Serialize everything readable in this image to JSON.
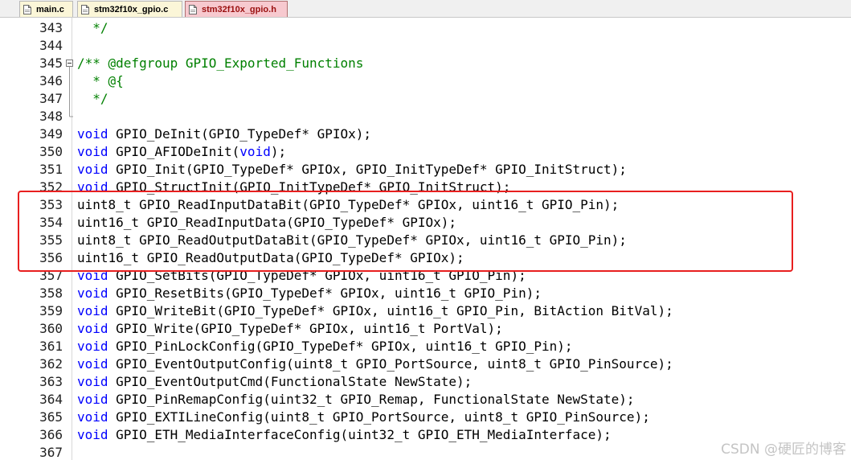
{
  "tabs": [
    {
      "label": "main.c",
      "active": false,
      "icon": "c-file-icon"
    },
    {
      "label": "stm32f10x_gpio.c",
      "active": false,
      "icon": "c-file-icon"
    },
    {
      "label": "stm32f10x_gpio.h",
      "active": true,
      "icon": "h-file-icon"
    }
  ],
  "highlight_color": "#e81f1f",
  "colors": {
    "keyword": "#0000ff",
    "comment": "#008000",
    "tab_active": "#f7c9cf",
    "tab_inactive": "#fbf6d8"
  },
  "watermark": "CSDN @硬匠的博客",
  "lines": [
    {
      "num": "343",
      "fold": "none",
      "parts": [
        {
          "t": "  */",
          "c": "cm"
        }
      ]
    },
    {
      "num": "344",
      "fold": "none",
      "parts": []
    },
    {
      "num": "345",
      "fold": "open",
      "parts": [
        {
          "t": "/** @defgroup GPIO_Exported_Functions",
          "c": "cm"
        }
      ]
    },
    {
      "num": "346",
      "fold": "line",
      "parts": [
        {
          "t": "  * @{",
          "c": "cm"
        }
      ]
    },
    {
      "num": "347",
      "fold": "line",
      "parts": [
        {
          "t": "  */",
          "c": "cm"
        }
      ]
    },
    {
      "num": "348",
      "fold": "end",
      "parts": []
    },
    {
      "num": "349",
      "fold": "none",
      "parts": [
        {
          "t": "void",
          "c": "kw"
        },
        {
          "t": " GPIO_DeInit(GPIO_TypeDef* GPIOx);",
          "c": ""
        }
      ]
    },
    {
      "num": "350",
      "fold": "none",
      "parts": [
        {
          "t": "void",
          "c": "kw"
        },
        {
          "t": " GPIO_AFIODeInit(",
          "c": ""
        },
        {
          "t": "void",
          "c": "kw"
        },
        {
          "t": ");",
          "c": ""
        }
      ]
    },
    {
      "num": "351",
      "fold": "none",
      "parts": [
        {
          "t": "void",
          "c": "kw"
        },
        {
          "t": " GPIO_Init(GPIO_TypeDef* GPIOx, GPIO_InitTypeDef* GPIO_InitStruct);",
          "c": ""
        }
      ]
    },
    {
      "num": "352",
      "fold": "none",
      "parts": [
        {
          "t": "void",
          "c": "kw"
        },
        {
          "t": " GPIO_StructInit(GPIO_InitTypeDef* GPIO_InitStruct);",
          "c": ""
        }
      ]
    },
    {
      "num": "353",
      "fold": "none",
      "parts": [
        {
          "t": "uint8_t GPIO_ReadInputDataBit(GPIO_TypeDef* GPIOx, uint16_t GPIO_Pin);",
          "c": ""
        }
      ]
    },
    {
      "num": "354",
      "fold": "none",
      "parts": [
        {
          "t": "uint16_t GPIO_ReadInputData(GPIO_TypeDef* GPIOx);",
          "c": ""
        }
      ]
    },
    {
      "num": "355",
      "fold": "none",
      "parts": [
        {
          "t": "uint8_t GPIO_ReadOutputDataBit(GPIO_TypeDef* GPIOx, uint16_t GPIO_Pin);",
          "c": ""
        }
      ]
    },
    {
      "num": "356",
      "fold": "none",
      "parts": [
        {
          "t": "uint16_t GPIO_ReadOutputData(GPIO_TypeDef* GPIOx);",
          "c": ""
        }
      ]
    },
    {
      "num": "357",
      "fold": "none",
      "parts": [
        {
          "t": "void",
          "c": "kw"
        },
        {
          "t": " GPIO_SetBits(GPIO_TypeDef* GPIOx, uint16_t GPIO_Pin);",
          "c": ""
        }
      ]
    },
    {
      "num": "358",
      "fold": "none",
      "parts": [
        {
          "t": "void",
          "c": "kw"
        },
        {
          "t": " GPIO_ResetBits(GPIO_TypeDef* GPIOx, uint16_t GPIO_Pin);",
          "c": ""
        }
      ]
    },
    {
      "num": "359",
      "fold": "none",
      "parts": [
        {
          "t": "void",
          "c": "kw"
        },
        {
          "t": " GPIO_WriteBit(GPIO_TypeDef* GPIOx, uint16_t GPIO_Pin, BitAction BitVal);",
          "c": ""
        }
      ]
    },
    {
      "num": "360",
      "fold": "none",
      "parts": [
        {
          "t": "void",
          "c": "kw"
        },
        {
          "t": " GPIO_Write(GPIO_TypeDef* GPIOx, uint16_t PortVal);",
          "c": ""
        }
      ]
    },
    {
      "num": "361",
      "fold": "none",
      "parts": [
        {
          "t": "void",
          "c": "kw"
        },
        {
          "t": " GPIO_PinLockConfig(GPIO_TypeDef* GPIOx, uint16_t GPIO_Pin);",
          "c": ""
        }
      ]
    },
    {
      "num": "362",
      "fold": "none",
      "parts": [
        {
          "t": "void",
          "c": "kw"
        },
        {
          "t": " GPIO_EventOutputConfig(uint8_t GPIO_PortSource, uint8_t GPIO_PinSource);",
          "c": ""
        }
      ]
    },
    {
      "num": "363",
      "fold": "none",
      "parts": [
        {
          "t": "void",
          "c": "kw"
        },
        {
          "t": " GPIO_EventOutputCmd(FunctionalState NewState);",
          "c": ""
        }
      ]
    },
    {
      "num": "364",
      "fold": "none",
      "parts": [
        {
          "t": "void",
          "c": "kw"
        },
        {
          "t": " GPIO_PinRemapConfig(uint32_t GPIO_Remap, FunctionalState NewState);",
          "c": ""
        }
      ]
    },
    {
      "num": "365",
      "fold": "none",
      "parts": [
        {
          "t": "void",
          "c": "kw"
        },
        {
          "t": " GPIO_EXTILineConfig(uint8_t GPIO_PortSource, uint8_t GPIO_PinSource);",
          "c": ""
        }
      ]
    },
    {
      "num": "366",
      "fold": "none",
      "parts": [
        {
          "t": "void",
          "c": "kw"
        },
        {
          "t": " GPIO_ETH_MediaInterfaceConfig(uint32_t GPIO_ETH_MediaInterface);",
          "c": ""
        }
      ]
    },
    {
      "num": "367",
      "fold": "none",
      "parts": []
    }
  ]
}
